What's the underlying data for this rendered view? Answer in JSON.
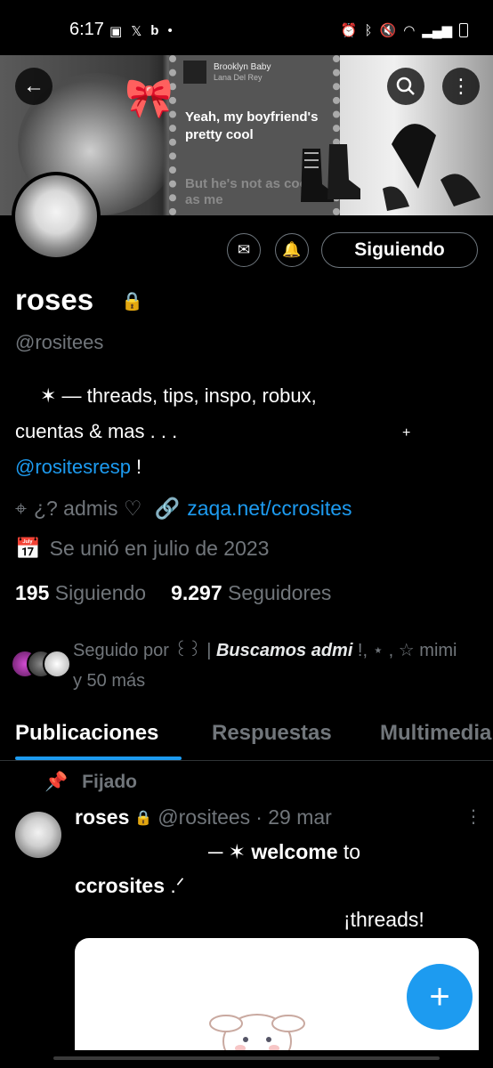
{
  "status_bar": {
    "time": "6:17",
    "left_icons": [
      "image-icon",
      "x-icon",
      "bing-icon",
      "dot-icon"
    ],
    "right_icons": [
      "alarm-icon",
      "bluetooth-icon",
      "mute-icon",
      "wifi-icon",
      "signal-icon",
      "battery-icon"
    ]
  },
  "banner": {
    "song_title": "Brooklyn Baby",
    "song_artist": "Lana Del Rey",
    "lyric_current": "Yeah, my boyfriend's pretty cool",
    "lyric_next": "But he's not as cool as me"
  },
  "header_buttons": [
    "back-icon",
    "search-icon",
    "more-vertical-icon"
  ],
  "actions": {
    "follow_label": "Siguiendo"
  },
  "profile": {
    "display_name": "roses",
    "handle": "@rositees",
    "bio_line1": "✶ — threads, tips, inspo, robux,",
    "bio_line2": "cuentas & mas . . .",
    "bio_mention": "@rositesresp",
    "bio_suffix": " !",
    "bio_deco": "+",
    "location": "¿? admis ♡",
    "website": "zaqa.net/ccrosites",
    "joined": "Se unió en julio de 2023",
    "following_count": "195",
    "following_label": "Siguiendo",
    "followers_count": "9.297",
    "followers_label": "Seguidores",
    "followed_by_prefix": "Seguido por ꒰꒱ | ",
    "followed_by_bold": "Buscamos admi",
    "followed_by_suffix": " !, ⋆ , ☆ mimi y 50 más"
  },
  "tabs": [
    "Publicaciones",
    "Respuestas",
    "Multimedia"
  ],
  "post": {
    "pinned_label": "Fijado",
    "author": "roses",
    "handle": "@rositees",
    "date": "· 29 mar",
    "line1_prefix": "─ ✶ ",
    "line1_bold": "welcome",
    "line1_suffix": " to",
    "line2_bold": "ccrosites",
    "line2_suffix": " .ᐟ",
    "line3": "¡threads!"
  },
  "fab_label": "+",
  "colors": {
    "accent": "#1d9bf0",
    "background": "#000000",
    "secondary_text": "#71767b"
  }
}
